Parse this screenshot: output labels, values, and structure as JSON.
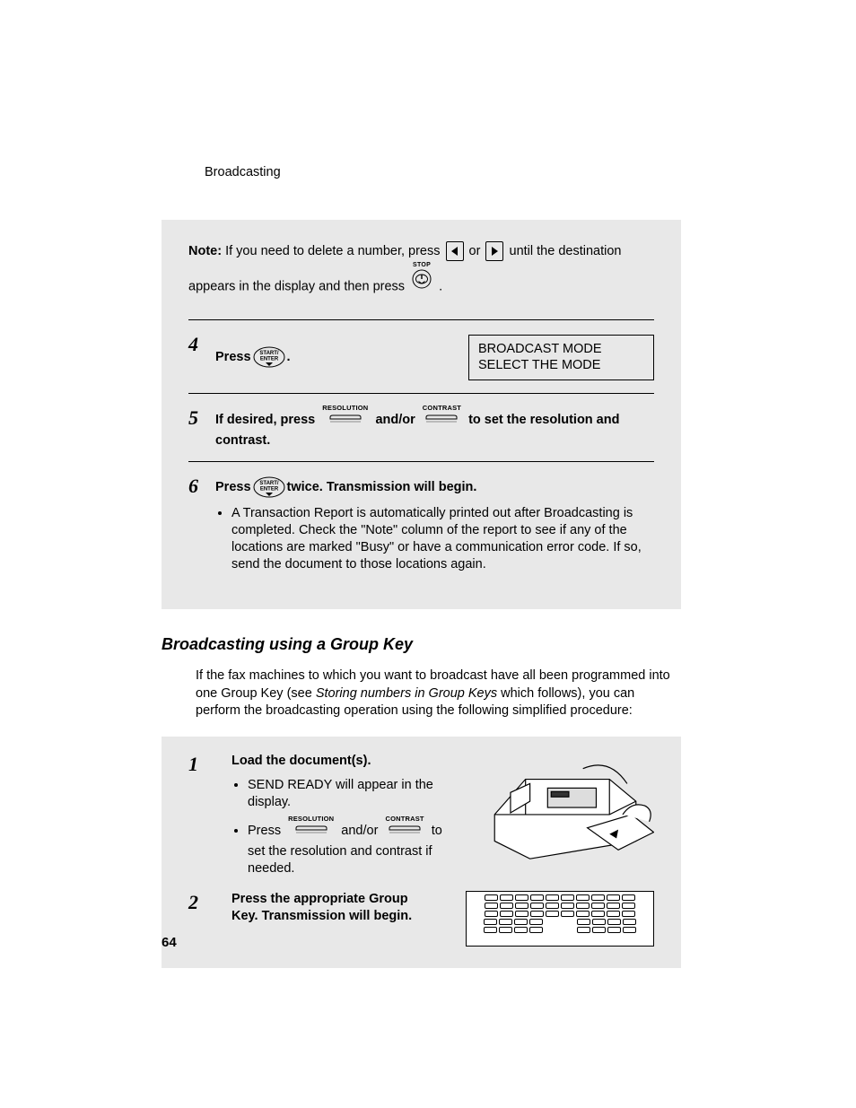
{
  "runningHead": "Broadcasting",
  "pageNumber": "64",
  "noteBox": {
    "label": "Note:",
    "part1": " If you need to delete a number, press ",
    "or": " or ",
    "part2": " until the destination appears in the display and then press ",
    "period": " ."
  },
  "icons": {
    "stopLabel": "STOP",
    "startEnterLine1": "START/",
    "startEnterLine2": "ENTER",
    "resolutionLabel": "RESOLUTION",
    "contrastLabel": "CONTRAST"
  },
  "steps": {
    "s4": {
      "num": "4",
      "text_a": "Press ",
      "text_b": "."
    },
    "s5": {
      "num": "5",
      "text_a": "If desired, press ",
      "andor": " and/or ",
      "text_b": " to set the resolution and contrast."
    },
    "s6": {
      "num": "6",
      "text_a": "Press ",
      "text_b": " twice. Transmission will begin.",
      "bullet": "A Transaction Report is automatically printed out after Broadcasting is completed. Check the \"Note\" column of the report to see if any of the locations are marked \"Busy\" or have a communication error code. If so, send the document to those locations again."
    }
  },
  "lcd": {
    "line1": "BROADCAST MODE",
    "line2": "SELECT THE MODE"
  },
  "section2": {
    "heading": "Broadcasting using a Group Key",
    "intro_a": "If the fax machines to which you want to broadcast have all been programmed into one Group Key (see ",
    "intro_ital": "Storing numbers in Group Keys",
    "intro_b": " which follows), you can perform the broadcasting operation using the following simplified procedure:",
    "s1": {
      "num": "1",
      "head": "Load the document(s).",
      "b1": "SEND READY will appear in the display.",
      "b2_a": "Press ",
      "b2_andor": " and/or ",
      "b2_b": " to set the resolution and contrast if needed."
    },
    "s2": {
      "num": "2",
      "head": "Press the appropriate Group Key. Transmission will begin."
    }
  }
}
